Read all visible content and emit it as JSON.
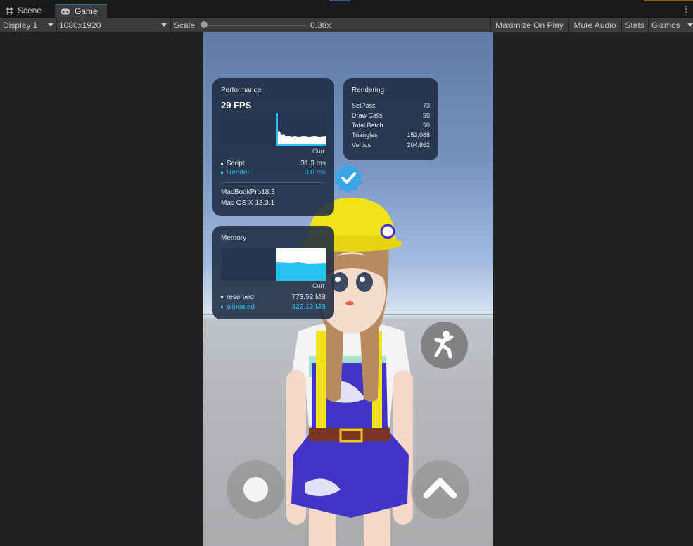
{
  "tabs": [
    {
      "label": "Scene",
      "icon": "grid-icon"
    },
    {
      "label": "Game",
      "icon": "gamepad-icon"
    }
  ],
  "toolbar": {
    "display": "Display 1",
    "resolution": "1080x1920",
    "scale_label": "Scale",
    "scale_value": "0.38x",
    "maximize": "Maximize On Play",
    "mute": "Mute Audio",
    "stats": "Stats",
    "gizmos": "Gizmos"
  },
  "performance": {
    "title": "Performance",
    "fps": "29 FPS",
    "curr": "Curr",
    "script_label": "Script",
    "script_value": "31.3 ms",
    "render_label": "Render",
    "render_value": "3.0 ms",
    "device": "MacBookPro18.3",
    "os": "Mac OS X 13.3.1"
  },
  "rendering": {
    "title": "Rendering",
    "rows": [
      {
        "label": "SetPass",
        "value": "73"
      },
      {
        "label": "Draw Calls",
        "value": "90"
      },
      {
        "label": "Total Batch",
        "value": "90"
      },
      {
        "label": "Triangles",
        "value": "152,088"
      },
      {
        "label": "Vertics",
        "value": "204,862"
      }
    ]
  },
  "memory": {
    "title": "Memory",
    "curr": "Curr",
    "reserved_label": "reserved",
    "reserved_value": "773.52 MB",
    "allocated_label": "allocated",
    "allocated_value": "322.12 MB"
  },
  "colors": {
    "accent_cyan": "#27c2ef",
    "panel_bg": "#1e2c42",
    "editor_bg": "#222222",
    "toolbar_bg": "#3c3c3c",
    "badge_blue": "#3aa6e8",
    "helmet_yellow": "#f2e21a",
    "overalls_blue": "#4035c8"
  }
}
